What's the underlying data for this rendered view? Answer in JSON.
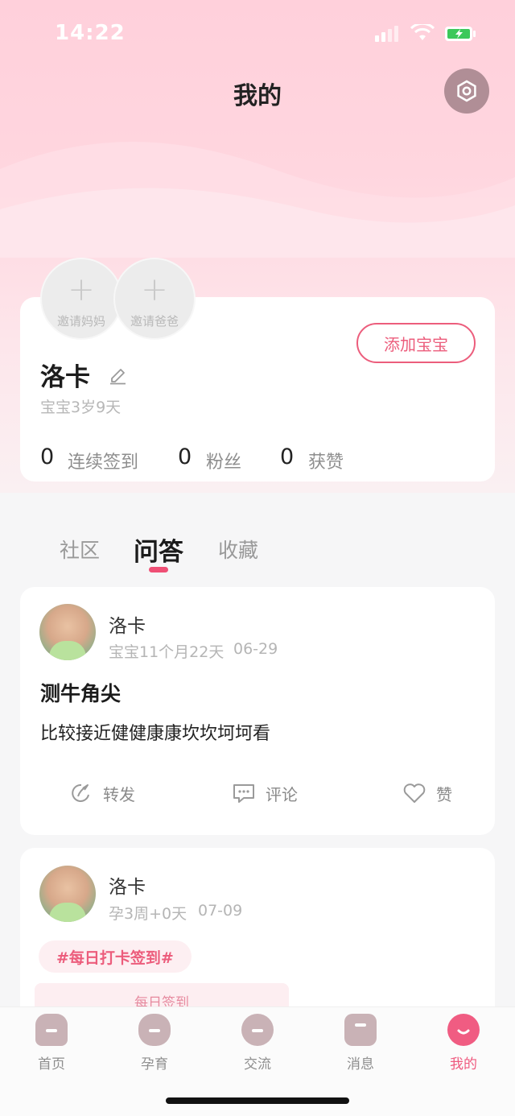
{
  "status_bar": {
    "time": "14:22"
  },
  "header": {
    "title": "我的"
  },
  "profile": {
    "invites": [
      {
        "label": "邀请妈妈"
      },
      {
        "label": "邀请爸爸"
      }
    ],
    "add_baby_label": "添加宝宝",
    "name": "洛卡",
    "baby_age": "宝宝3岁9天",
    "stats": [
      {
        "value": "0",
        "label": "连续签到"
      },
      {
        "value": "0",
        "label": "粉丝"
      },
      {
        "value": "0",
        "label": "获赞"
      }
    ]
  },
  "tabs": [
    {
      "label": "社区",
      "active": false
    },
    {
      "label": "问答",
      "active": true
    },
    {
      "label": "收藏",
      "active": false
    }
  ],
  "posts": [
    {
      "author": "洛卡",
      "meta_age": "宝宝11个月22天",
      "meta_date": "06-29",
      "title": "测牛角尖",
      "body": "比较接近健健康康坎坎坷坷看",
      "actions": {
        "share": "转发",
        "comment": "评论",
        "like": "赞"
      }
    },
    {
      "author": "洛卡",
      "meta_age": "孕3周+0天",
      "meta_date": "07-09",
      "tag": "#每日打卡签到#",
      "checkin_label": "每日签到"
    }
  ],
  "bottom_nav": [
    {
      "label": "首页",
      "icon": "home-icon"
    },
    {
      "label": "孕育",
      "icon": "bear-icon"
    },
    {
      "label": "交流",
      "icon": "chat-icon"
    },
    {
      "label": "消息",
      "icon": "message-icon"
    },
    {
      "label": "我的",
      "icon": "profile-smile-icon",
      "active": true
    }
  ],
  "colors": {
    "accent": "#ef5a7f",
    "hero_pink": "#ffd0db",
    "icon_muted": "#c9b2b6"
  }
}
